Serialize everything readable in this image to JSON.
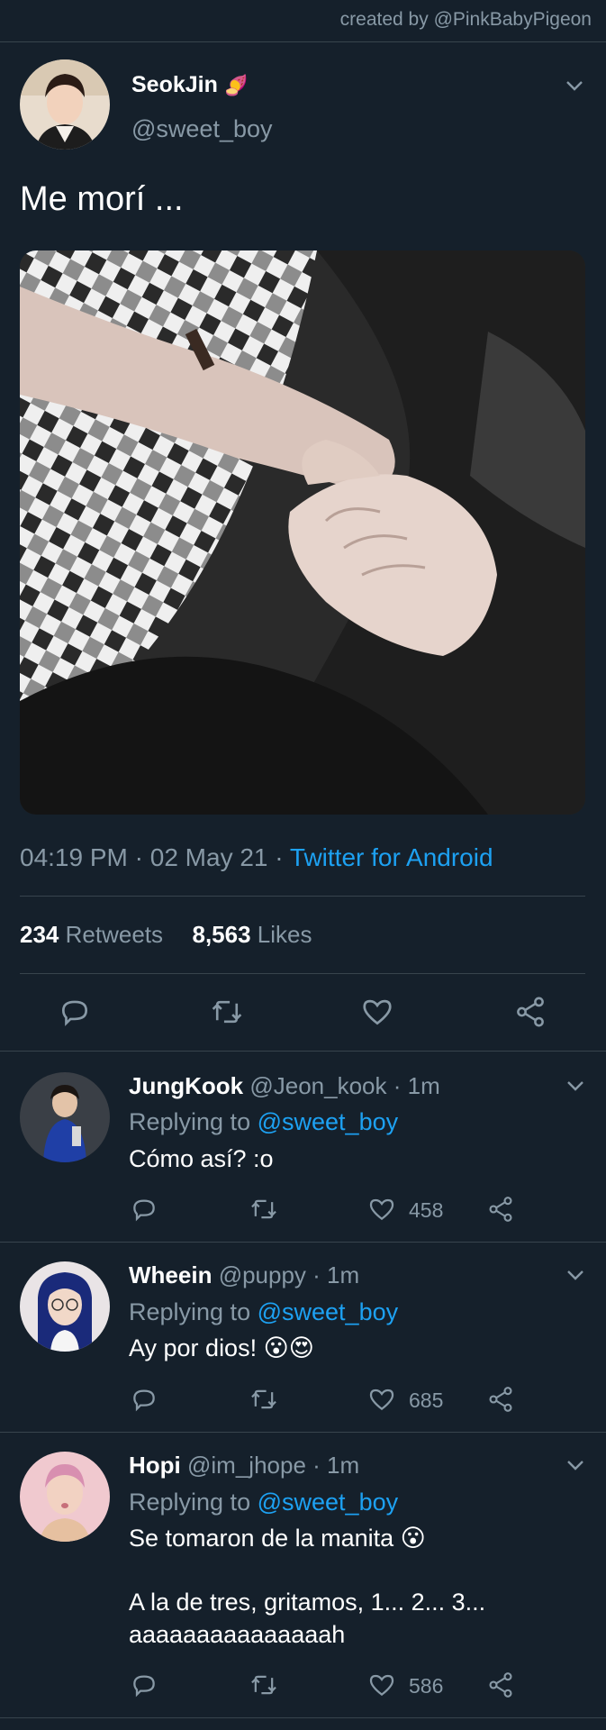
{
  "credit": "created by @PinkBabyPigeon",
  "tweet": {
    "name": "SeokJin",
    "name_emoji": "🍠",
    "handle": "@sweet_boy",
    "text": "Me morí ...",
    "time": "04:19 PM",
    "date": "02 May 21",
    "source": "Twitter for Android",
    "retweets_count": "234",
    "retweets_label": "Retweets",
    "likes_count": "8,563",
    "likes_label": "Likes"
  },
  "replies": [
    {
      "name": "JungKook",
      "handle": "@Jeon_kook",
      "time": "1m",
      "replying_prefix": "Replying to",
      "replying_to": "@sweet_boy",
      "lines": [
        "Cómo así? :o"
      ],
      "likes": "458"
    },
    {
      "name": "Wheein",
      "handle": "@puppy",
      "time": "1m",
      "replying_prefix": "Replying to",
      "replying_to": "@sweet_boy",
      "lines": [
        "Ay por dios! 😮😍"
      ],
      "likes": "685"
    },
    {
      "name": "Hopi",
      "handle": "@im_jhope",
      "time": "1m",
      "replying_prefix": "Replying to",
      "replying_to": "@sweet_boy",
      "lines": [
        "Se tomaron de la manita 😮",
        "A la de tres, gritamos, 1... 2... 3...",
        "aaaaaaaaaaaaaaah"
      ],
      "likes": "586"
    }
  ],
  "colors": {
    "background": "#15202b",
    "divider": "#38444d",
    "secondary_text": "#8899a6",
    "accent": "#1da1f2"
  },
  "icons": [
    "chevron-down-icon",
    "reply-icon",
    "retweet-icon",
    "like-icon",
    "share-icon"
  ]
}
